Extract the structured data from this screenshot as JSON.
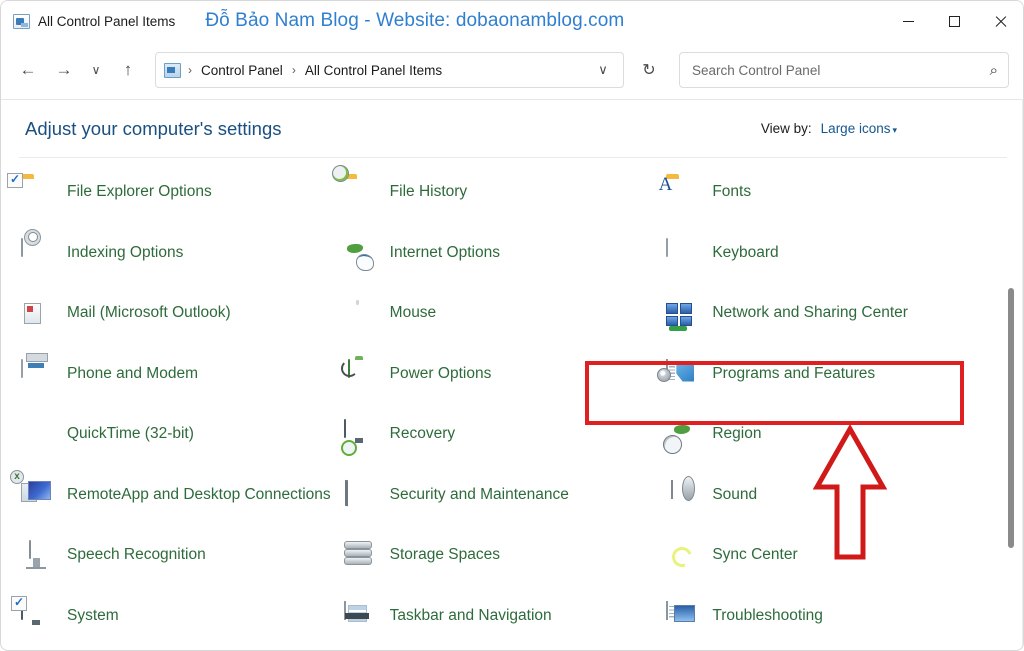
{
  "window": {
    "title": "All Control Panel Items",
    "watermark": "Đỗ Bảo Nam Blog - Website: dobaonamblog.com",
    "controls": {
      "minimize": "–",
      "maximize": "□",
      "close": "✕"
    }
  },
  "nav": {
    "back": "←",
    "forward": "→",
    "recent": "∨",
    "up": "↑",
    "breadcrumb": [
      "Control Panel",
      "All Control Panel Items"
    ],
    "separator": "›",
    "history_caret": "∨",
    "refresh": "↻"
  },
  "search": {
    "placeholder": "Search Control Panel",
    "value": "",
    "icon": "⌕"
  },
  "header": {
    "title": "Adjust your computer's settings",
    "view_by_label": "View by:",
    "view_by_value": "Large icons",
    "view_by_caret": "▾"
  },
  "items": [
    {
      "label": "File Explorer Options",
      "icon": "folder-check-icon"
    },
    {
      "label": "File History",
      "icon": "folder-clock-icon"
    },
    {
      "label": "Fonts",
      "icon": "folder-font-icon"
    },
    {
      "label": "Indexing Options",
      "icon": "disk-magnifier-icon"
    },
    {
      "label": "Internet Options",
      "icon": "globe-list-icon"
    },
    {
      "label": "Keyboard",
      "icon": "keyboard-icon"
    },
    {
      "label": "Mail (Microsoft Outlook)",
      "icon": "mail-globe-icon"
    },
    {
      "label": "Mouse",
      "icon": "mouse-icon"
    },
    {
      "label": "Network and Sharing Center",
      "icon": "network-icon"
    },
    {
      "label": "Phone and Modem",
      "icon": "fax-modem-icon"
    },
    {
      "label": "Power Options",
      "icon": "battery-plug-icon"
    },
    {
      "label": "Programs and Features",
      "icon": "programs-disc-icon"
    },
    {
      "label": "QuickTime (32-bit)",
      "icon": "quicktime-icon"
    },
    {
      "label": "Recovery",
      "icon": "monitor-clock-icon"
    },
    {
      "label": "Region",
      "icon": "globe-clock-icon"
    },
    {
      "label": "RemoteApp and Desktop Connections",
      "icon": "remoteapp-icon"
    },
    {
      "label": "Security and Maintenance",
      "icon": "flag-icon"
    },
    {
      "label": "Sound",
      "icon": "speaker-icon"
    },
    {
      "label": "Speech Recognition",
      "icon": "microphone-icon"
    },
    {
      "label": "Storage Spaces",
      "icon": "disk-stack-icon"
    },
    {
      "label": "Sync Center",
      "icon": "sync-icon"
    },
    {
      "label": "System",
      "icon": "monitor-check-icon"
    },
    {
      "label": "Taskbar and Navigation",
      "icon": "taskbar-icon"
    },
    {
      "label": "Troubleshooting",
      "icon": "troubleshooting-icon"
    }
  ],
  "annotations": {
    "highlight_target": "Programs and Features",
    "highlight_color": "#e02020",
    "arrow_direction": "up"
  },
  "colors": {
    "item_label": "#2e6b3b",
    "header_title": "#1a4f82",
    "link": "#15578f",
    "watermark": "#2f7fd0",
    "annotation_red": "#e02020"
  }
}
